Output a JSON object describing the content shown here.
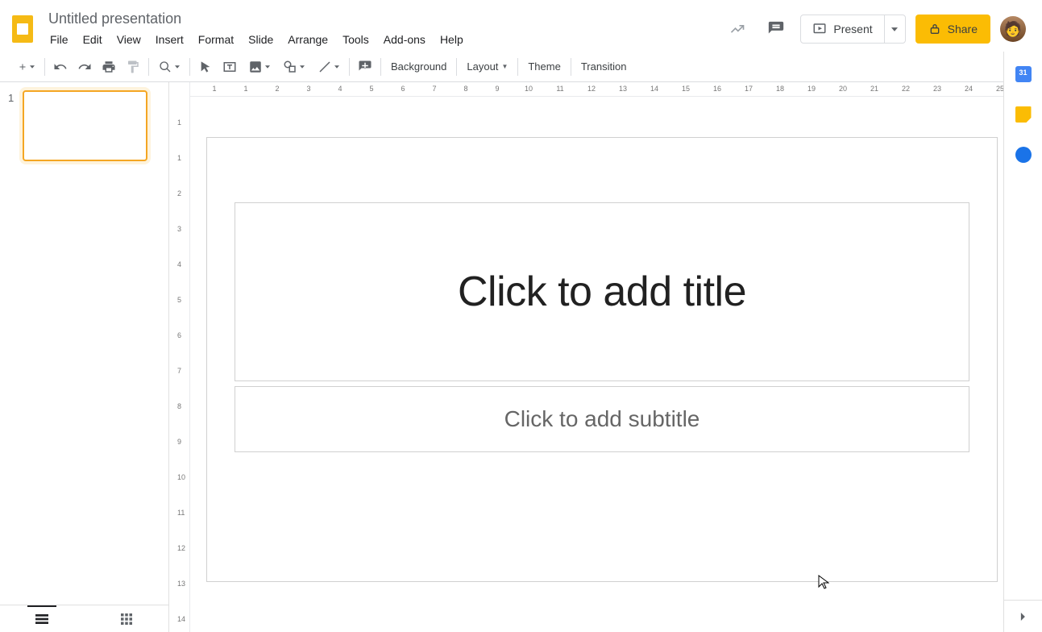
{
  "header": {
    "doc_title": "Untitled presentation",
    "present_label": "Present",
    "share_label": "Share"
  },
  "menu": {
    "items": [
      "File",
      "Edit",
      "View",
      "Insert",
      "Format",
      "Slide",
      "Arrange",
      "Tools",
      "Add-ons",
      "Help"
    ]
  },
  "toolbar": {
    "background_label": "Background",
    "layout_label": "Layout",
    "theme_label": "Theme",
    "transition_label": "Transition"
  },
  "filmstrip": {
    "slides": [
      {
        "number": "1"
      }
    ]
  },
  "canvas": {
    "title_placeholder": "Click to add title",
    "subtitle_placeholder": "Click to add subtitle"
  },
  "ruler": {
    "h_ticks": [
      "1",
      "1",
      "2",
      "3",
      "4",
      "5",
      "6",
      "7",
      "8",
      "9",
      "10",
      "11",
      "12",
      "13",
      "14",
      "15",
      "16",
      "17",
      "18",
      "19",
      "20",
      "21",
      "22",
      "23",
      "24",
      "25"
    ],
    "v_ticks": [
      "1",
      "1",
      "2",
      "3",
      "4",
      "5",
      "6",
      "7",
      "8",
      "9",
      "10",
      "11",
      "12",
      "13",
      "14"
    ]
  },
  "sidepanel": {
    "apps": [
      "calendar",
      "keep",
      "tasks"
    ]
  }
}
